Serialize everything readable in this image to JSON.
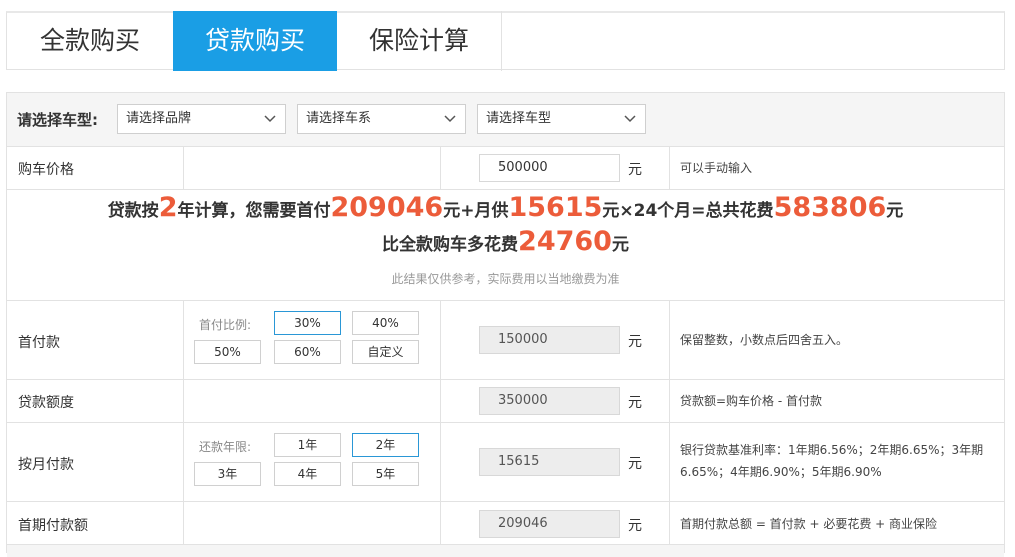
{
  "tabs": [
    {
      "label": "全款购买",
      "active": false
    },
    {
      "label": "贷款购买",
      "active": true
    },
    {
      "label": "保险计算",
      "active": false
    }
  ],
  "car_select": {
    "label": "请选择车型:",
    "brand_placeholder": "请选择品牌",
    "series_placeholder": "请选择车系",
    "model_placeholder": "请选择车型"
  },
  "price": {
    "label": "购车价格",
    "value": "500000",
    "unit": "元",
    "note": "可以手动输入"
  },
  "result": {
    "p1": "贷款按",
    "years": "2",
    "p2": "年计算，您需要首付",
    "down_payment": "209046",
    "p3": "元+月供",
    "monthly": "15615",
    "p4": "元×24个月=总共花费",
    "total": "583806",
    "p5": "元",
    "p6": "比全款购车多花费",
    "extra": "24760",
    "p7": "元",
    "disclaimer": "此结果仅供参考，实际费用以当地缴费为准"
  },
  "down": {
    "label": "首付款",
    "ratio_label": "首付比例:",
    "options": [
      "30%",
      "40%",
      "50%",
      "60%",
      "自定义"
    ],
    "selected": "30%",
    "value": "150000",
    "unit": "元",
    "note": "保留整数，小数点后四舍五入。"
  },
  "amount": {
    "label": "贷款额度",
    "value": "350000",
    "unit": "元",
    "note": "贷款额=购车价格 - 首付款"
  },
  "monthly_payment": {
    "label": "按月付款",
    "term_label": "还款年限:",
    "options": [
      "1年",
      "2年",
      "3年",
      "4年",
      "5年"
    ],
    "selected": "2年",
    "value": "15615",
    "unit": "元",
    "note_line1": "银行贷款基准利率：1年期6.56%；2年期6.65%；3年期",
    "note_line2": "6.65%；4年期6.90%；5年期6.90%"
  },
  "first_payment": {
    "label": "首期付款额",
    "value": "209046",
    "unit": "元",
    "note": "首期付款总额 = 首付款 + 必要花费 + 商业保险"
  },
  "colors": {
    "accent": "#1a9ee5",
    "highlight": "#ec5c3a",
    "active_border": "#2a97d6"
  },
  "icons": {
    "select_chevron": "chevron-down-icon"
  }
}
